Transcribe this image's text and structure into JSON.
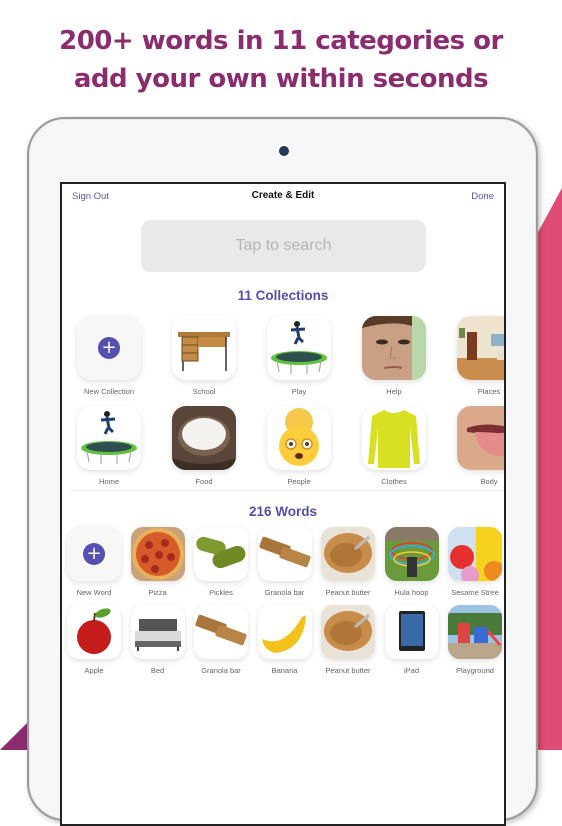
{
  "headline": {
    "line1": "200+ words in 11 categories or",
    "line2": "add your own within seconds"
  },
  "colors": {
    "headline": "#8b2c6e",
    "accent": "#5350b0",
    "stripe_pink": "#e04c75",
    "stripe_purple": "#8b2c6e"
  },
  "navbar": {
    "left": "Sign Out",
    "title": "Create & Edit",
    "right": "Done"
  },
  "search": {
    "placeholder": "Tap to search"
  },
  "collections": {
    "title": "11 Collections",
    "row1": [
      {
        "label": "New Collection",
        "icon": "plus-icon"
      },
      {
        "label": "School",
        "icon": "desk-image"
      },
      {
        "label": "Play",
        "icon": "trampoline-image"
      },
      {
        "label": "Help",
        "icon": "face-image"
      },
      {
        "label": "Places",
        "icon": "room-image"
      }
    ],
    "row2": [
      {
        "label": "Home",
        "icon": "trampoline-image"
      },
      {
        "label": "Food",
        "icon": "rice-image"
      },
      {
        "label": "People",
        "icon": "grandma-emoji"
      },
      {
        "label": "Clothes",
        "icon": "sweater-image"
      },
      {
        "label": "Body",
        "icon": "tongue-image"
      }
    ]
  },
  "words": {
    "title": "216 Words",
    "row1": [
      {
        "label": "New Word",
        "icon": "plus-icon"
      },
      {
        "label": "Pizza",
        "icon": "pizza-image"
      },
      {
        "label": "Pickles",
        "icon": "pickles-image"
      },
      {
        "label": "Granola bar",
        "icon": "granola-image"
      },
      {
        "label": "Peanut butter",
        "icon": "peanut-butter-image"
      },
      {
        "label": "Hula hoop",
        "icon": "hula-hoop-image"
      },
      {
        "label": "Sesame Stree",
        "icon": "sesame-street-image"
      }
    ],
    "row2": [
      {
        "label": "Apple",
        "icon": "apple-image"
      },
      {
        "label": "Bed",
        "icon": "bed-image"
      },
      {
        "label": "Granola bar",
        "icon": "granola-image"
      },
      {
        "label": "Banana",
        "icon": "banana-image"
      },
      {
        "label": "Peanut butter",
        "icon": "peanut-butter-image"
      },
      {
        "label": "iPad",
        "icon": "ipad-image"
      },
      {
        "label": "Playground",
        "icon": "playground-image"
      }
    ]
  }
}
